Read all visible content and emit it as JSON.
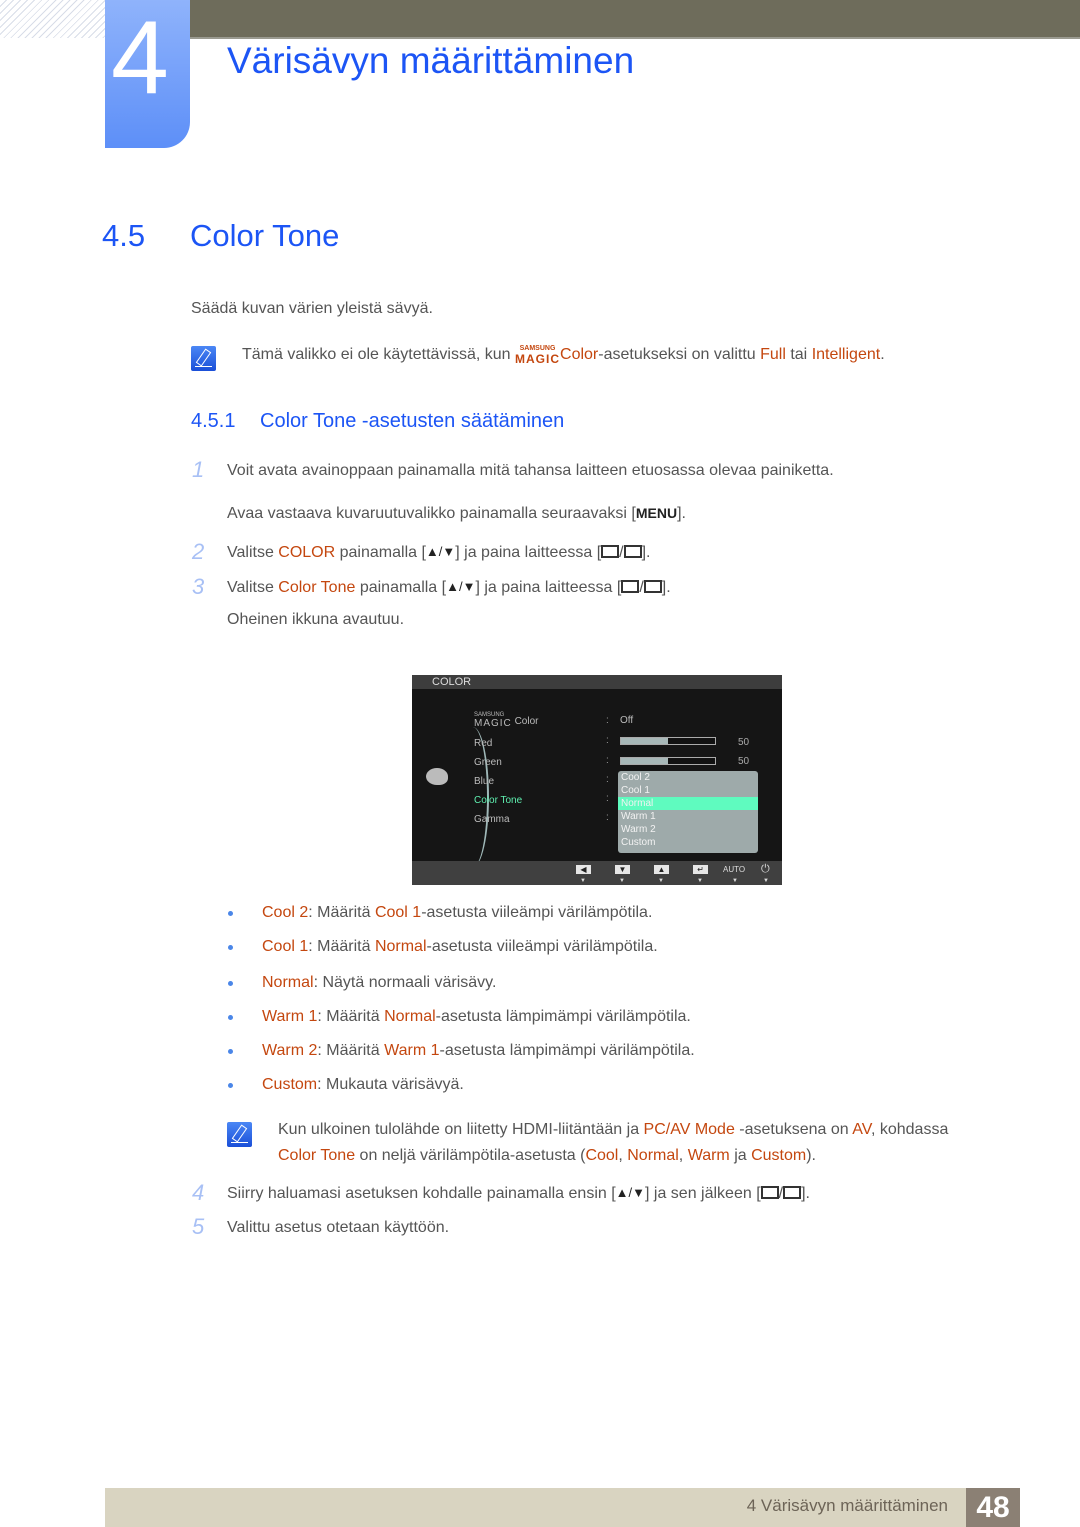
{
  "chapter": {
    "number": "4",
    "title": "Värisävyn määrittäminen"
  },
  "section": {
    "number": "4.5",
    "title": "Color Tone"
  },
  "intro": "Säädä kuvan värien yleistä sävyä.",
  "note1": {
    "before": "Tämä valikko ei ole käytettävissä, kun ",
    "magic_top": "SAMSUNG",
    "magic_bottom": "MAGIC",
    "color": "Color",
    "middle": "-asetukseksi on valittu ",
    "full": "Full",
    "tai": " tai ",
    "intelligent": "Intelligent",
    "end": "."
  },
  "subsection": {
    "number": "4.5.1",
    "title": "Color Tone -asetusten säätäminen"
  },
  "steps": {
    "s1": {
      "num": "1",
      "text": "Voit avata avainoppaan painamalla mitä tahansa laitteen etuosassa olevaa painiketta."
    },
    "s1b": {
      "before": "Avaa vastaava kuvaruutuvalikko painamalla seuraavaksi [",
      "key": "MENU",
      "after": "]."
    },
    "s2": {
      "num": "2",
      "a": "Valitse ",
      "hl": "COLOR",
      "b": " painamalla [",
      "arrows": "▲/▼",
      "c": "] ja paina laitteessa [",
      "d": "]."
    },
    "s3": {
      "num": "3",
      "a": "Valitse ",
      "hl": "Color Tone",
      "b": " painamalla [",
      "arrows": "▲/▼",
      "c": "] ja paina laitteessa [",
      "d": "]."
    },
    "s3b": "Oheinen ikkuna avautuu.",
    "s4": {
      "num": "4",
      "a": "Siirry haluamasi asetuksen kohdalle painamalla ensin [",
      "arrows": "▲/▼",
      "b": "] ja sen jälkeen [",
      "c": "]."
    },
    "s5": {
      "num": "5",
      "text": "Valittu asetus otetaan käyttöön."
    }
  },
  "osd": {
    "header": "COLOR",
    "magic_top": "SAMSUNG",
    "magic_bottom": "MAGIC",
    "magic_label": "Color",
    "magic_value": "Off",
    "items": [
      "Red",
      "Green",
      "Blue",
      "Color Tone",
      "Gamma"
    ],
    "red_value": "50",
    "green_value": "50",
    "red_fill": 0.5,
    "green_fill": 0.5,
    "dropdown": [
      "Cool 2",
      "Cool 1",
      "Normal",
      "Warm 1",
      "Warm 2",
      "Custom"
    ],
    "selected": "Normal",
    "footer_auto": "AUTO",
    "colors": {
      "selected_item": "#5ffbbf",
      "active_label": "#5ff0b0"
    }
  },
  "bullets": [
    {
      "term": "Cool 2",
      "a": ": Määritä ",
      "ref": "Cool 1",
      "b": "-asetusta viileämpi värilämpötila."
    },
    {
      "term": "Cool 1",
      "a": ": Määritä ",
      "ref": "Normal",
      "b": "-asetusta viileämpi värilämpötila."
    },
    {
      "term": "Normal",
      "a": ": Näytä normaali värisävy.",
      "ref": "",
      "b": ""
    },
    {
      "term": "Warm 1",
      "a": ": Määritä ",
      "ref": "Normal",
      "b": "-asetusta lämpimämpi värilämpötila."
    },
    {
      "term": "Warm 2",
      "a": ": Määritä ",
      "ref": "Warm 1",
      "b": "-asetusta lämpimämpi värilämpötila."
    },
    {
      "term": "Custom",
      "a": ": Mukauta värisävyä.",
      "ref": "",
      "b": ""
    }
  ],
  "note2": {
    "l1a": "Kun ulkoinen tulolähde on liitetty HDMI-liitäntään ja ",
    "pcav": "PC/AV Mode",
    "l1b": " -asetuksena on ",
    "av": "AV",
    "l1c": ", kohdassa",
    "ct": "Color Tone",
    "l2a": " on neljä värilämpötila-asetusta (",
    "cool": "Cool",
    "comma1": ", ",
    "normal": "Normal",
    "comma2": ", ",
    "warm": "Warm",
    "ja": " ja ",
    "custom": "Custom",
    "end": ")."
  },
  "footer": {
    "label": "4 Värisävyn määrittäminen",
    "page": "48"
  },
  "colors": {
    "heading": "#1c55f5",
    "highlight": "#c4470f",
    "body": "#555555",
    "step_number": "#a8c0f5"
  }
}
